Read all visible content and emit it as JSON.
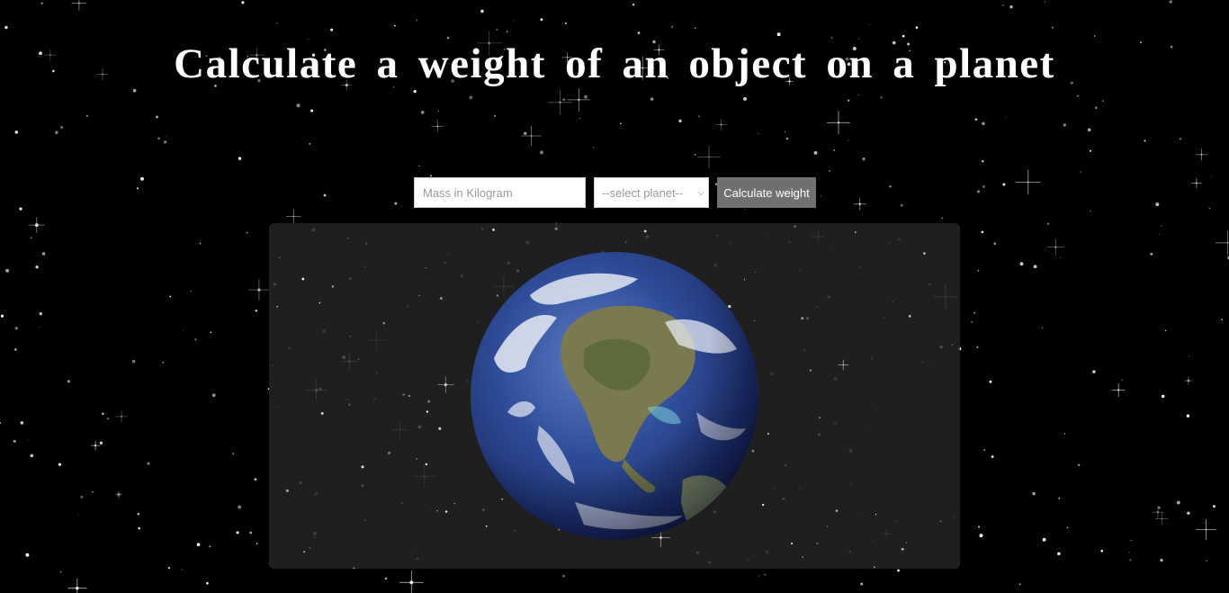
{
  "header": {
    "title": "Calculate a weight of an object on a planet"
  },
  "form": {
    "mass_placeholder": "Mass in Kilogram",
    "mass_value": "",
    "planet_selected": "--select planet--",
    "calculate_label": "Calculate weight"
  },
  "display": {
    "planet_image": "earth-globe",
    "panel_color": "#262626",
    "button_color": "#707070",
    "background_color": "#000000"
  }
}
